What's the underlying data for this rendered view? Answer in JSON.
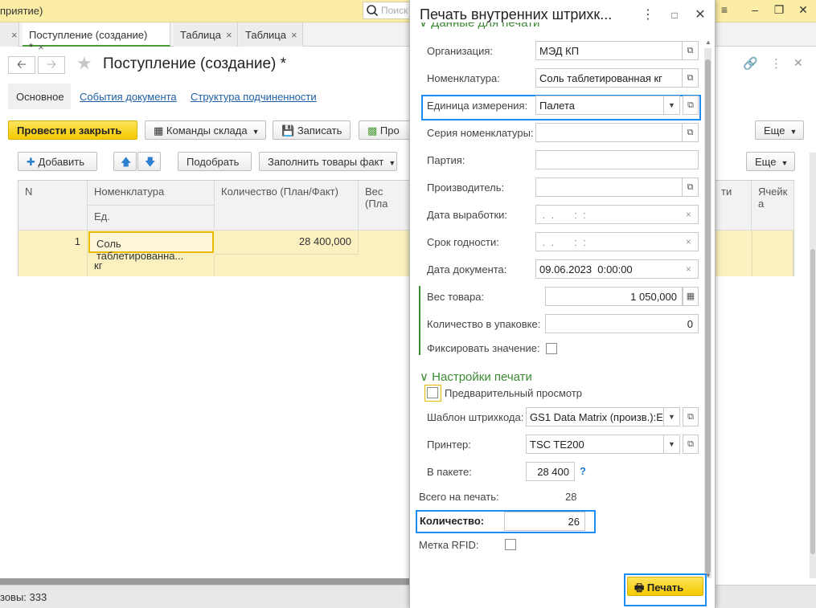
{
  "app": {
    "title_fragment": "приятие)",
    "search_placeholder": "Поиск",
    "window_controls": [
      "menu-icon",
      "minimize-icon",
      "restore-icon",
      "close-icon"
    ]
  },
  "tabs": [
    {
      "label": "Поступление (создание) *",
      "active": true
    },
    {
      "label": "Таблица",
      "active": false
    },
    {
      "label": "Таблица",
      "active": false
    }
  ],
  "doc": {
    "title": "Поступление (создание) *",
    "subtabs": [
      "Основное",
      "События документа",
      "Структура подчиненности"
    ]
  },
  "toolbar": {
    "post_close": "Провести и закрыть",
    "warehouse_cmds": "Команды склада",
    "save": "Записать",
    "print_cut": "Про",
    "more": "Еще"
  },
  "table_toolbar": {
    "add": "Добавить",
    "pick": "Подобрать",
    "fill": "Заполнить товары факт",
    "more": "Еще"
  },
  "table": {
    "headers": {
      "n": "N",
      "item": "Номенклатура",
      "unit": "Ед.",
      "qty": "Количество (План/Факт)",
      "weight": "Вес (Пла",
      "col_cut": "ти",
      "cell": "Ячейк а"
    },
    "rows": [
      {
        "n": "1",
        "item": "Соль таблетированна...",
        "unit": "кг",
        "qty": "28 400,000"
      }
    ]
  },
  "status": {
    "text": "зовы: 333"
  },
  "dialog": {
    "title": "Печать внутренних штрихк...",
    "section_data": "Данные для печати",
    "section_print": "Настройки печати",
    "fields": {
      "org_label": "Организация:",
      "org_value": "МЭД КП",
      "item_label": "Номенклатура:",
      "item_value": "Соль таблетированная кг",
      "unit_label": "Единица измерения:",
      "unit_value": "Палета",
      "series_label": "Серия номенклатуры:",
      "series_value": "",
      "batch_label": "Партия:",
      "batch_value": "",
      "maker_label": "Производитель:",
      "maker_value": "",
      "prod_date_label": "Дата выработки:",
      "prod_date_value": " .  .       :  :",
      "expiry_label": "Срок годности:",
      "expiry_value": " .  .       :  :",
      "doc_date_label": "Дата документа:",
      "doc_date_value": "09.06.2023  0:00:00",
      "weight_label": "Вес товара:",
      "weight_value": "1 050,000",
      "pack_qty_label": "Количество в упаковке:",
      "pack_qty_value": "0",
      "fix_label": "Фиксировать значение:",
      "preview_label": "Предварительный просмотр",
      "template_label": "Шаблон штрихкода:",
      "template_value": "GS1 Data Matrix (произв.):E",
      "printer_label": "Принтер:",
      "printer_value": "TSC TE200",
      "in_pack_label": "В пакете:",
      "in_pack_value": "28 400",
      "help": "?",
      "total_label": "Всего на печать:",
      "total_value": "28",
      "count_label": "Количество:",
      "count_value": "26",
      "rfid_label": "Метка RFID:"
    },
    "print_button": "Печать"
  }
}
